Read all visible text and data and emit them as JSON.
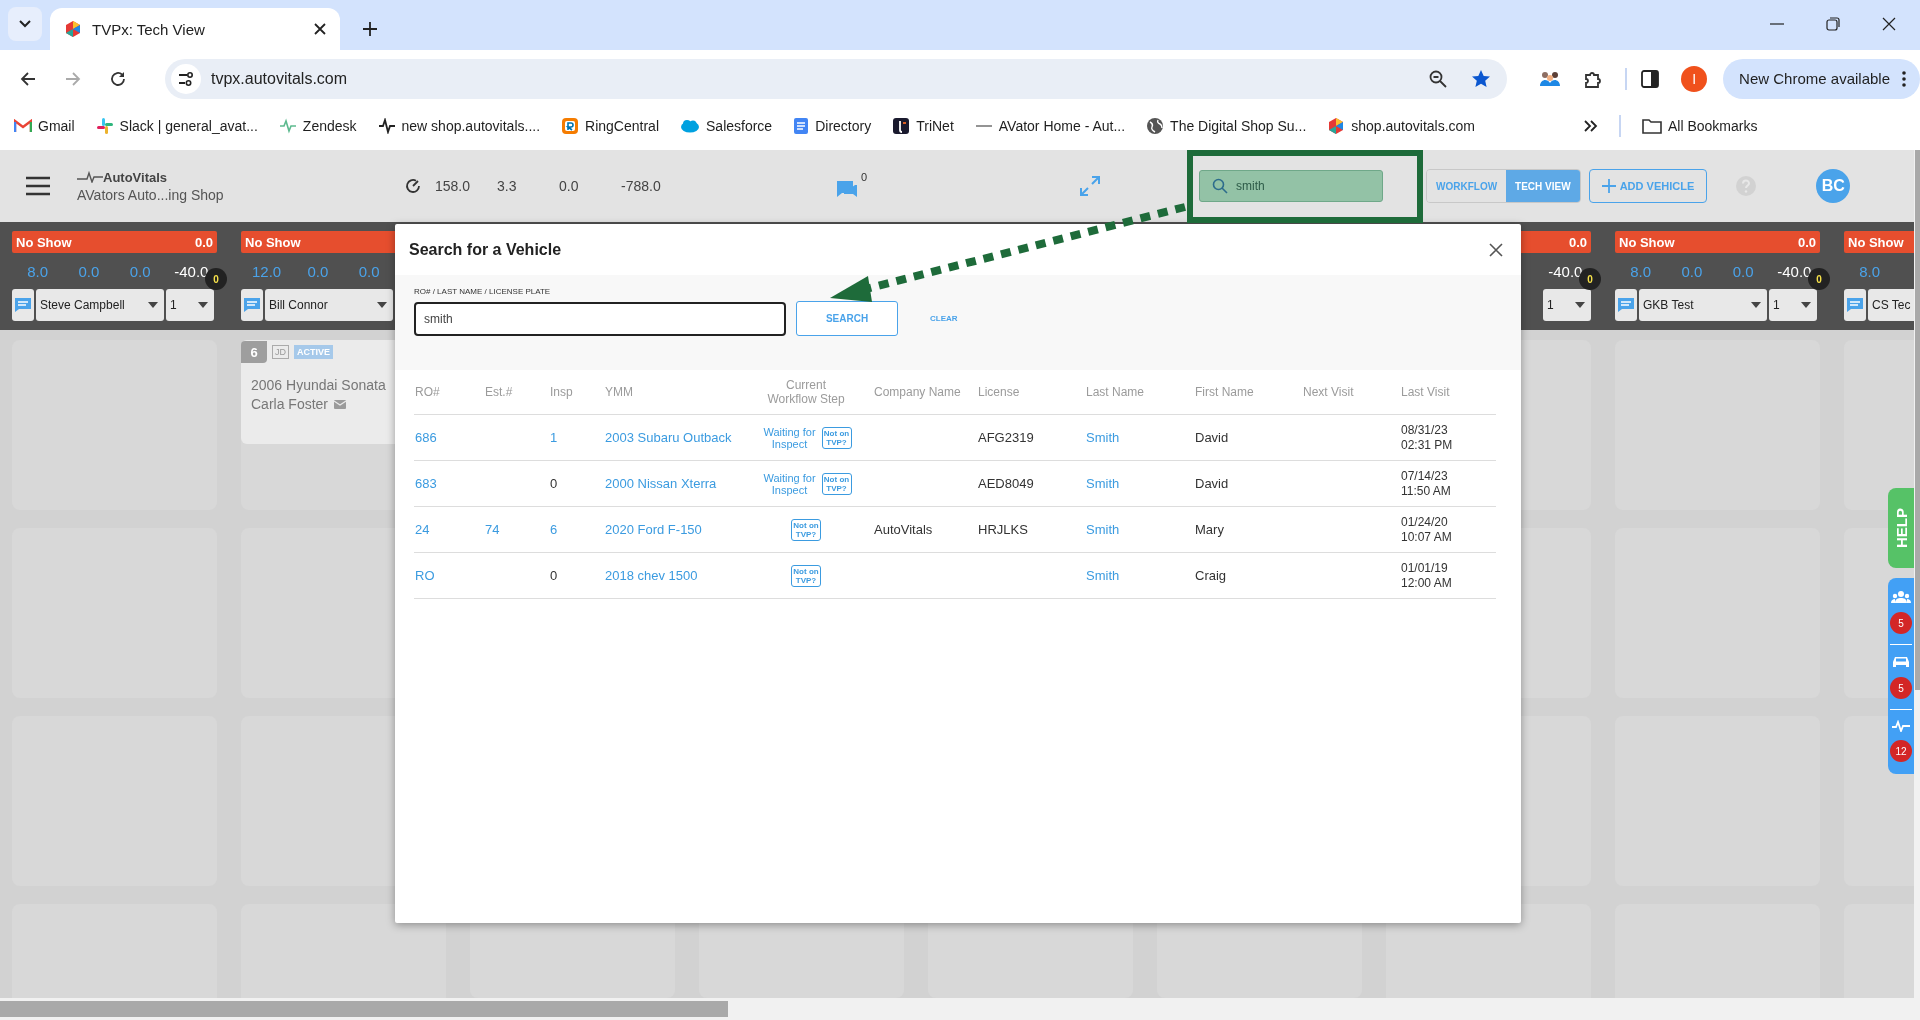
{
  "browser": {
    "tabs": [
      {
        "title": "TVPx: Tech View",
        "selected": true
      }
    ],
    "url": "tvpx.autovitals.com",
    "profile": "I",
    "update_button": "New Chrome available",
    "bookmarks": [
      {
        "kind": "gmail",
        "label": "Gmail"
      },
      {
        "kind": "slack",
        "label": "Slack | general_avat..."
      },
      {
        "kind": "zendesk",
        "label": "Zendesk"
      },
      {
        "kind": "pulse",
        "label": "new shop.autovitals...."
      },
      {
        "kind": "ringcentral",
        "label": "RingCentral"
      },
      {
        "kind": "salesforce",
        "label": "Salesforce"
      },
      {
        "kind": "doc",
        "label": "Directory"
      },
      {
        "kind": "trinet",
        "label": "TriNet"
      },
      {
        "kind": "line",
        "label": "AVator Home - Aut..."
      },
      {
        "kind": "globe",
        "label": "The Digital Shop Su..."
      },
      {
        "kind": "hexagon",
        "label": "shop.autovitals.com"
      }
    ],
    "all_bookmarks": "All Bookmarks"
  },
  "header": {
    "logo": "AutoVitals",
    "shop": "AVators Auto...ing Shop",
    "stats": [
      "158.0",
      "3.3",
      "0.0",
      "-788.0"
    ],
    "chat_count": "0",
    "search": {
      "value": "smith"
    },
    "view_tabs": [
      {
        "label": "WORKFLOW",
        "selected": false
      },
      {
        "label": "TECH VIEW",
        "selected": true
      }
    ],
    "add_vehicle": "ADD VEHICLE",
    "avatar": "BC"
  },
  "columns": [
    {
      "label": "No Show",
      "value": "0.0",
      "stats": [
        {
          "text": "8.0",
          "color": "#4aa3ea"
        },
        {
          "text": "0.0",
          "color": "#4aa3ea"
        },
        {
          "text": "0.0",
          "color": "#4aa3ea"
        },
        {
          "text": "-40.0",
          "color": "#ffffff"
        }
      ],
      "tech": "Steve Campbell",
      "count": "1",
      "badge": "0"
    },
    {
      "label": "No Show",
      "stats": [
        {
          "text": "12.0",
          "color": "#4aa3ea"
        },
        {
          "text": "0.0",
          "color": "#4aa3ea"
        },
        {
          "text": "0.0",
          "color": "#4aa3ea"
        }
      ],
      "tech": "Bill Connor",
      "card": {
        "number": "6",
        "initials": "JD",
        "status": "ACTIVE",
        "vehicle": "2006 Hyundai Sonata",
        "customer": "Carla Foster"
      }
    },
    {
      "value": "0.0",
      "stats": [
        {
          "text": "-40.0",
          "color": "#ffffff"
        }
      ],
      "count": "1",
      "badge": "0"
    },
    {
      "label": "No Show",
      "value": "0.0",
      "stats": [
        {
          "text": "8.0",
          "color": "#4aa3ea"
        },
        {
          "text": "0.0",
          "color": "#4aa3ea"
        },
        {
          "text": "0.0",
          "color": "#4aa3ea"
        },
        {
          "text": "-40.0",
          "color": "#ffffff"
        }
      ],
      "tech": "GKB Test",
      "count": "1",
      "badge": "0"
    },
    {
      "label": "No Show",
      "stats": [
        {
          "text": "8.0",
          "color": "#4aa3ea"
        }
      ],
      "tech": "CS Tec"
    }
  ],
  "modal": {
    "title": "Search for a Vehicle",
    "field_label": "RO# / LAST NAME / LICENSE PLATE",
    "field_value": "smith",
    "search_button": "SEARCH",
    "clear_link": "CLEAR",
    "table": {
      "columns": [
        "RO#",
        "Est.#",
        "Insp",
        "YMM",
        "Current Workflow Step",
        "Company Name",
        "License",
        "Last Name",
        "First Name",
        "Next Visit",
        "Last Visit"
      ],
      "rows": [
        {
          "ro": "686",
          "insp": {
            "text": "1",
            "link": true
          },
          "ymm": "2003 Subaru Outback",
          "step": "Waiting for Inspect",
          "tag": "Not on TVP?",
          "license": "AFG2319",
          "last_name": "Smith",
          "first_name": "David",
          "last_visit": "08/31/23 02:31 PM"
        },
        {
          "ro": "683",
          "insp": {
            "text": "0",
            "link": false
          },
          "ymm": "2000 Nissan Xterra",
          "step": "Waiting for Inspect",
          "tag": "Not on TVP?",
          "license": "AED8049",
          "last_name": "Smith",
          "first_name": "David",
          "last_visit": "07/14/23 11:50 AM"
        },
        {
          "ro": "24",
          "est": "74",
          "insp": {
            "text": "6",
            "link": true
          },
          "ymm": "2020 Ford F-150",
          "tag": "Not on TVP?",
          "company": "AutoVitals",
          "license": "HRJLKS",
          "last_name": "Smith",
          "first_name": "Mary",
          "last_visit": "01/24/20 10:07 AM"
        },
        {
          "ro": "RO",
          "insp": {
            "text": "0",
            "link": false
          },
          "ymm": "2018 chev 1500",
          "tag": "Not on TVP?",
          "last_name": "Smith",
          "first_name": "Craig",
          "last_visit": "01/01/19 12:00 AM"
        }
      ]
    }
  },
  "side_panel": {
    "help": "HELP",
    "counters": [
      {
        "kind": "people",
        "count": "5"
      },
      {
        "kind": "car",
        "count": "5"
      },
      {
        "kind": "pulse",
        "count": "12"
      }
    ]
  }
}
